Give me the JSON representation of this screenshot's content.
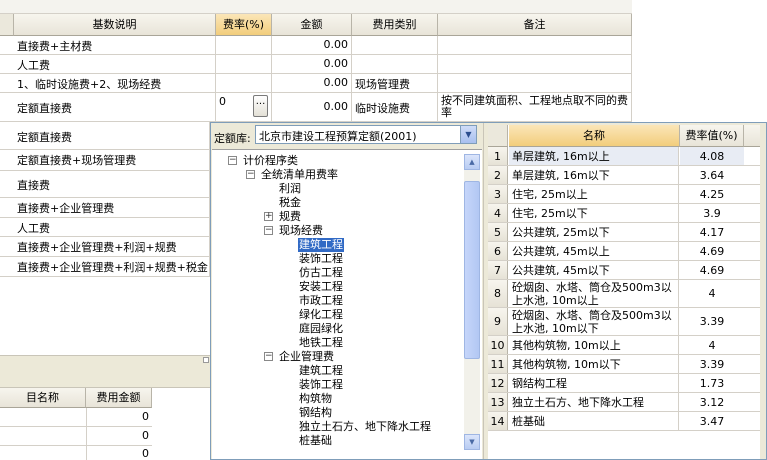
{
  "main_grid": {
    "headers": [
      "基数说明",
      "费率(%)",
      "金额",
      "费用类别",
      "备注"
    ],
    "rows": [
      {
        "base": "直接费+主材费",
        "rate": "",
        "amount": "0.00",
        "category": "",
        "note": ""
      },
      {
        "base": "人工费",
        "rate": "",
        "amount": "0.00",
        "category": "",
        "note": ""
      },
      {
        "base": "1、临时设施费+2、现场经费",
        "rate": "",
        "amount": "0.00",
        "category": "现场管理费",
        "note": ""
      },
      {
        "base": "定额直接费",
        "rate": "0",
        "amount": "0.00",
        "category": "临时设施费",
        "note": "按不同建筑面积、工程地点取不同的费率"
      },
      {
        "base": "定额直接费"
      },
      {
        "base": "定额直接费+现场管理费"
      },
      {
        "base": "直接费"
      },
      {
        "base": "直接费+企业管理费"
      },
      {
        "base": "人工费"
      },
      {
        "base": "直接费+企业管理费+利润+规费"
      },
      {
        "base": "直接费+企业管理费+利润+规费+税金"
      }
    ]
  },
  "bottom_grid": {
    "headers": [
      "目名称",
      "费用金额"
    ],
    "values": [
      "0",
      "0",
      "0"
    ]
  },
  "popup": {
    "library_label": "定额库:",
    "library_value": "北京市建设工程预算定额(2001)",
    "tree": [
      {
        "label": "计价程序类",
        "level": 0,
        "toggle": "−"
      },
      {
        "label": "全统清单用费率",
        "level": 1,
        "toggle": "−"
      },
      {
        "label": "利润",
        "level": 2,
        "toggle": ""
      },
      {
        "label": "税金",
        "level": 2,
        "toggle": ""
      },
      {
        "label": "规费",
        "level": 2,
        "toggle": "+"
      },
      {
        "label": "现场经费",
        "level": 2,
        "toggle": "−"
      },
      {
        "label": "建筑工程",
        "level": 3,
        "toggle": "",
        "selected": true
      },
      {
        "label": "装饰工程",
        "level": 3,
        "toggle": ""
      },
      {
        "label": "仿古工程",
        "level": 3,
        "toggle": ""
      },
      {
        "label": "安装工程",
        "level": 3,
        "toggle": ""
      },
      {
        "label": "市政工程",
        "level": 3,
        "toggle": ""
      },
      {
        "label": "绿化工程",
        "level": 3,
        "toggle": ""
      },
      {
        "label": "庭园绿化",
        "level": 3,
        "toggle": ""
      },
      {
        "label": "地铁工程",
        "level": 3,
        "toggle": ""
      },
      {
        "label": "企业管理费",
        "level": 2,
        "toggle": "−"
      },
      {
        "label": "建筑工程",
        "level": 3,
        "toggle": ""
      },
      {
        "label": "装饰工程",
        "level": 3,
        "toggle": ""
      },
      {
        "label": "构筑物",
        "level": 3,
        "toggle": ""
      },
      {
        "label": "钢结构",
        "level": 3,
        "toggle": ""
      },
      {
        "label": "独立土石方、地下降水工程",
        "level": 3,
        "toggle": ""
      },
      {
        "label": "桩基础",
        "level": 3,
        "toggle": ""
      }
    ],
    "rate_table": {
      "headers": [
        "名称",
        "费率值(%)"
      ],
      "rows": [
        {
          "idx": "1",
          "name": "单层建筑, 16m以上",
          "value": "4.08"
        },
        {
          "idx": "2",
          "name": "单层建筑, 16m以下",
          "value": "3.64"
        },
        {
          "idx": "3",
          "name": "住宅, 25m以上",
          "value": "4.25"
        },
        {
          "idx": "4",
          "name": "住宅, 25m以下",
          "value": "3.9"
        },
        {
          "idx": "5",
          "name": "公共建筑, 25m以下",
          "value": "4.17"
        },
        {
          "idx": "6",
          "name": "公共建筑, 45m以上",
          "value": "4.69"
        },
        {
          "idx": "7",
          "name": "公共建筑, 45m以下",
          "value": "4.69"
        },
        {
          "idx": "8",
          "name": "砼烟囱、水塔、筒仓及500m3以上水池, 10m以上",
          "value": "4"
        },
        {
          "idx": "9",
          "name": "砼烟囱、水塔、筒仓及500m3以上水池, 10m以下",
          "value": "3.39"
        },
        {
          "idx": "10",
          "name": "其他构筑物, 10m以上",
          "value": "4"
        },
        {
          "idx": "11",
          "name": "其他构筑物, 10m以下",
          "value": "3.39"
        },
        {
          "idx": "12",
          "name": "钢结构工程",
          "value": "1.73"
        },
        {
          "idx": "13",
          "name": "独立土石方、地下降水工程",
          "value": "3.12"
        },
        {
          "idx": "14",
          "name": "桩基础",
          "value": "3.47"
        }
      ]
    }
  },
  "colors": {
    "header_bg": "#ebe8dc",
    "selected_header": "#f2cd7c",
    "tree_selected": "#316ac5",
    "popup_border": "#7f9db9"
  }
}
